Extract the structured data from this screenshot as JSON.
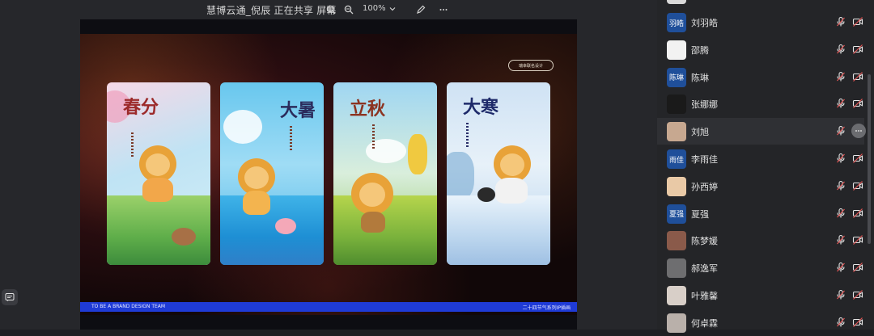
{
  "topbar": {
    "title": "慧博云通_倪辰  正在共享 屏幕",
    "zoom": "100%",
    "icons": [
      "zoom-in-icon",
      "zoom-out-icon",
      "pen-icon",
      "more-icon"
    ]
  },
  "slide": {
    "badge": "瑞幸联名设计",
    "cards": [
      {
        "title": "春分"
      },
      {
        "title": "大暑"
      },
      {
        "title": "立秋"
      },
      {
        "title": "大寒"
      }
    ],
    "footer_left": "TO BE A BRAND DESIGN TEAM",
    "footer_right": "二十四节气系列IP插画"
  },
  "participants": [
    {
      "name": "刘羽皓",
      "avatar_text": "羽皓",
      "avatar_type": "text"
    },
    {
      "name": "邵腾",
      "avatar_type": "image"
    },
    {
      "name": "陈琳",
      "avatar_text": "陈琳",
      "avatar_type": "text"
    },
    {
      "name": "张娜娜",
      "avatar_type": "image"
    },
    {
      "name": "刘旭",
      "avatar_type": "image",
      "highlighted": true
    },
    {
      "name": "李雨佳",
      "avatar_text": "雨佳",
      "avatar_type": "text"
    },
    {
      "name": "孙西婷",
      "avatar_type": "image"
    },
    {
      "name": "夏强",
      "avatar_text": "夏强",
      "avatar_type": "text"
    },
    {
      "name": "陈梦媛",
      "avatar_type": "image"
    },
    {
      "name": "郝逸军",
      "avatar_type": "image"
    },
    {
      "name": "叶雅馨",
      "avatar_type": "image"
    },
    {
      "name": "何卓霖",
      "avatar_type": "image"
    }
  ],
  "colors": {
    "accent_blue": "#1f3bd6",
    "mic_muted": "#e7e7e7",
    "cam_off": "#d9534f"
  }
}
